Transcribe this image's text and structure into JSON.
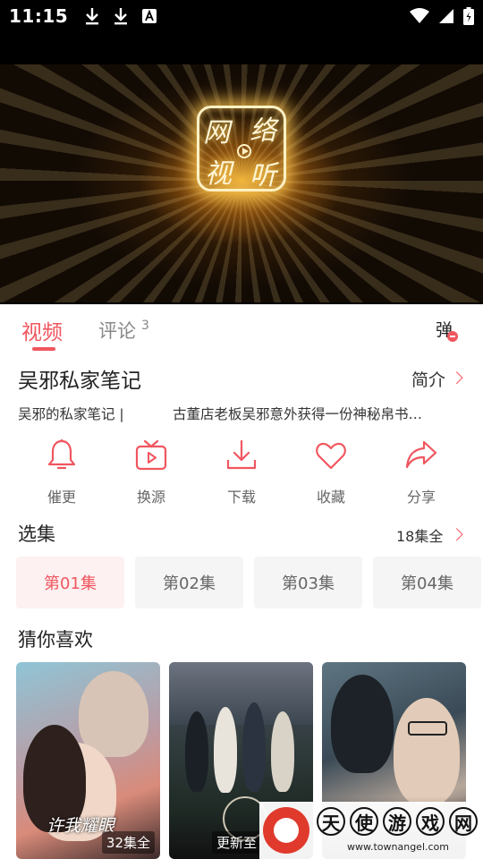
{
  "status_bar": {
    "time": "11:15"
  },
  "player": {
    "logo_chars": [
      "网",
      "络",
      "视",
      "听"
    ]
  },
  "tabs": {
    "video": "视频",
    "comments": "评论",
    "comments_count": "3",
    "danmaku": "弹"
  },
  "show": {
    "title": "吴邪私家笔记",
    "intro_label": "简介",
    "desc_left": "吴邪的私家笔记 |",
    "desc_right": "古董店老板吴邪意外获得一份神秘帛书…"
  },
  "actions": [
    {
      "label": "催更",
      "icon": "bell-icon"
    },
    {
      "label": "换源",
      "icon": "tv-play-icon"
    },
    {
      "label": "下载",
      "icon": "download-icon"
    },
    {
      "label": "收藏",
      "icon": "heart-icon"
    },
    {
      "label": "分享",
      "icon": "share-icon"
    }
  ],
  "episodes": {
    "title": "选集",
    "total": "18集全",
    "items": [
      "第01集",
      "第02集",
      "第03集",
      "第04集"
    ],
    "active_index": 0
  },
  "recommend": {
    "title": "猜你喜欢",
    "items": [
      {
        "badge": "32集全",
        "poster_text": "许我耀眼"
      },
      {
        "badge": "更新至"
      },
      {
        "badge": ""
      }
    ]
  },
  "watermark": {
    "chars": [
      "天",
      "使",
      "游",
      "戏",
      "网"
    ],
    "url": "www.townangel.com"
  },
  "colors": {
    "accent": "#f0565f",
    "grey_text": "#666666",
    "episode_bg": "#f5f5f5"
  }
}
